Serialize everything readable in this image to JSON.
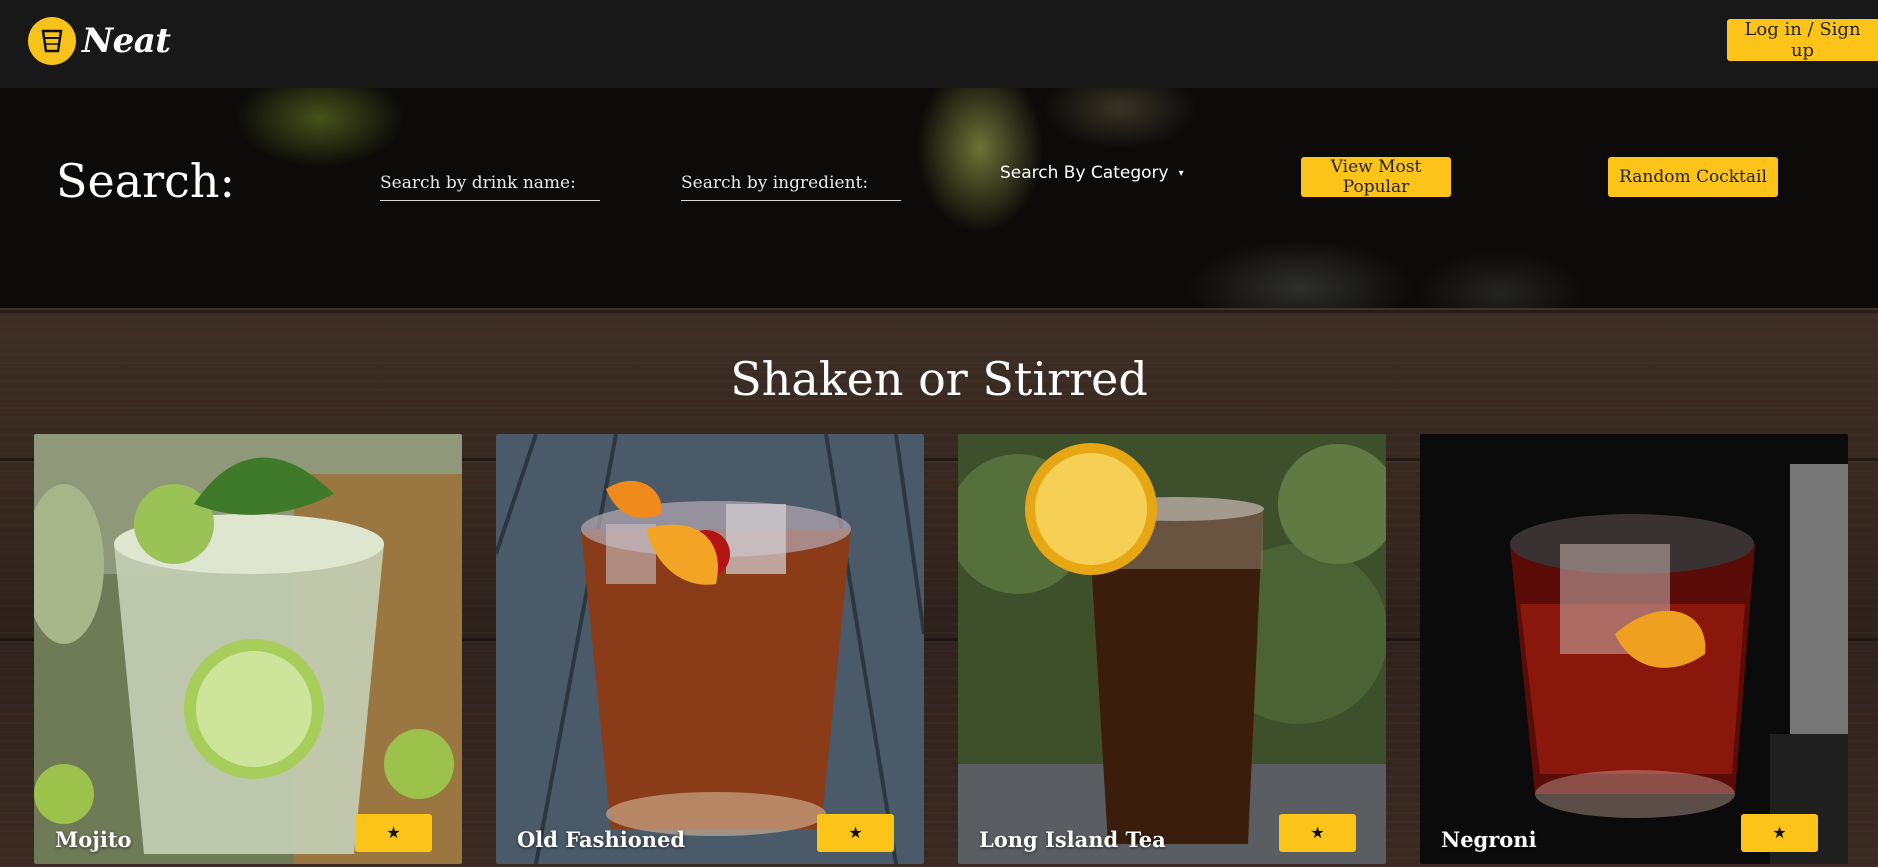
{
  "brand": {
    "name": "Neat",
    "color": "#fcc419",
    "logo_icon": "glass-icon"
  },
  "nav": {
    "login_label": "Log in / Sign up"
  },
  "search": {
    "title": "Search:",
    "drink_placeholder": "Search by drink name:",
    "ingredient_placeholder": "Search by ingredient:",
    "category_label": "Search By Category",
    "category_caret": "▾",
    "popular_label": "View Most Popular",
    "random_label": "Random Cocktail"
  },
  "section": {
    "title": "Shaken or Stirred"
  },
  "cards": [
    {
      "name": "Mojito",
      "fav_icon": "star-icon",
      "fav_glyph": "★"
    },
    {
      "name": "Old Fashioned",
      "fav_icon": "star-icon",
      "fav_glyph": "★"
    },
    {
      "name": "Long Island Tea",
      "fav_icon": "star-icon",
      "fav_glyph": "★"
    },
    {
      "name": "Negroni",
      "fav_icon": "star-icon",
      "fav_glyph": "★"
    }
  ]
}
